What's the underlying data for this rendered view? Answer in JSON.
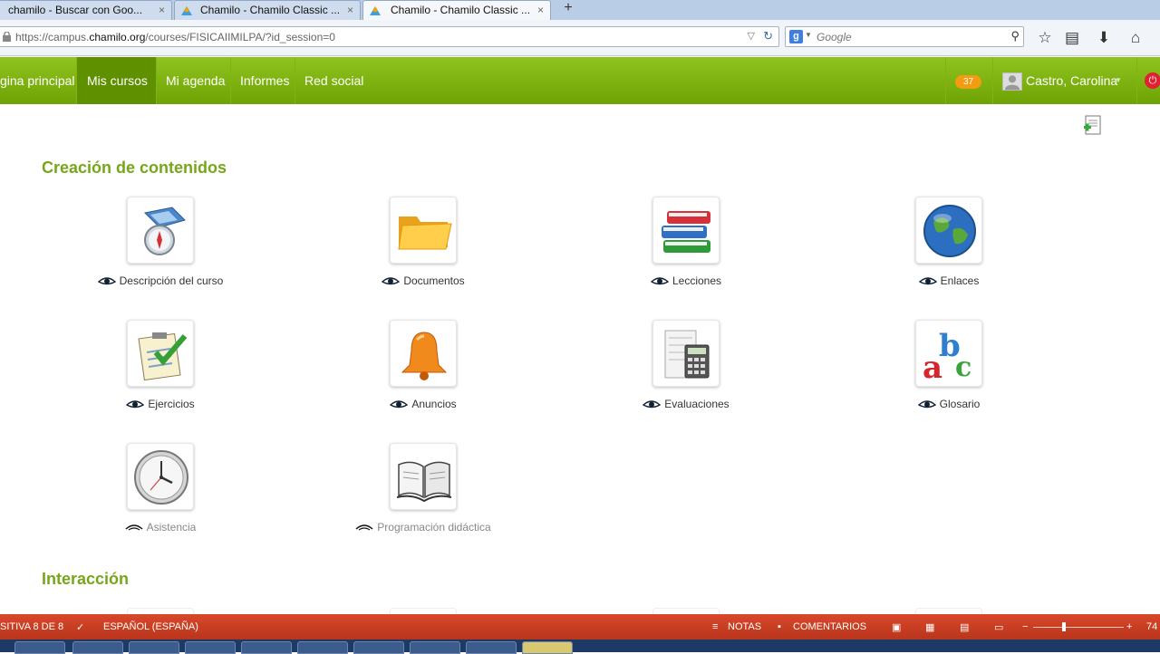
{
  "browser": {
    "tabs": [
      {
        "label": "chamilo - Buscar con Goo...",
        "close": "×"
      },
      {
        "label": "Chamilo - Chamilo Classic ...",
        "close": "×"
      },
      {
        "label": "Chamilo - Chamilo Classic ...",
        "close": "×",
        "active": true
      }
    ],
    "new_tab": "+",
    "url_prefix": "https://campus.",
    "url_host": "chamilo.org",
    "url_path": "/courses/FISICAIIMILPA/?id_session=0",
    "search_placeholder": "Google",
    "search_engine_letter": "g"
  },
  "menu": {
    "items": [
      "gina principal",
      "Mis cursos",
      "Mi agenda",
      "Informes",
      "Red social"
    ],
    "active_index": 1,
    "notifications": "37",
    "user": "Castro, Carolina"
  },
  "sections": [
    {
      "title": "Creación de contenidos",
      "tools": [
        {
          "label": "Descripción del curso",
          "icon": "compass-map-icon",
          "visible": true
        },
        {
          "label": "Documentos",
          "icon": "folder-icon",
          "visible": true
        },
        {
          "label": "Lecciones",
          "icon": "books-icon",
          "visible": true
        },
        {
          "label": "Enlaces",
          "icon": "globe-icon",
          "visible": true
        },
        {
          "label": "Ejercicios",
          "icon": "checklist-icon",
          "visible": true
        },
        {
          "label": "Anuncios",
          "icon": "bell-icon",
          "visible": true
        },
        {
          "label": "Evaluaciones",
          "icon": "calculator-icon",
          "visible": true
        },
        {
          "label": "Glosario",
          "icon": "abc-icon",
          "visible": true
        },
        {
          "label": "Asistencia",
          "icon": "clock-icon",
          "visible": false
        },
        {
          "label": "Programación didáctica",
          "icon": "open-book-icon",
          "visible": false
        }
      ]
    },
    {
      "title": "Interacción"
    }
  ],
  "statusbar": {
    "slide": "SITIVA 8 DE 8",
    "language": "ESPAÑOL (ESPAÑA)",
    "notes": "NOTAS",
    "comments": "COMENTARIOS",
    "zoom": "74"
  },
  "colors": {
    "menu_green": "#7cb40f",
    "section_green": "#76a71b",
    "status_red": "#c73f22",
    "badge_orange": "#f39c12"
  }
}
